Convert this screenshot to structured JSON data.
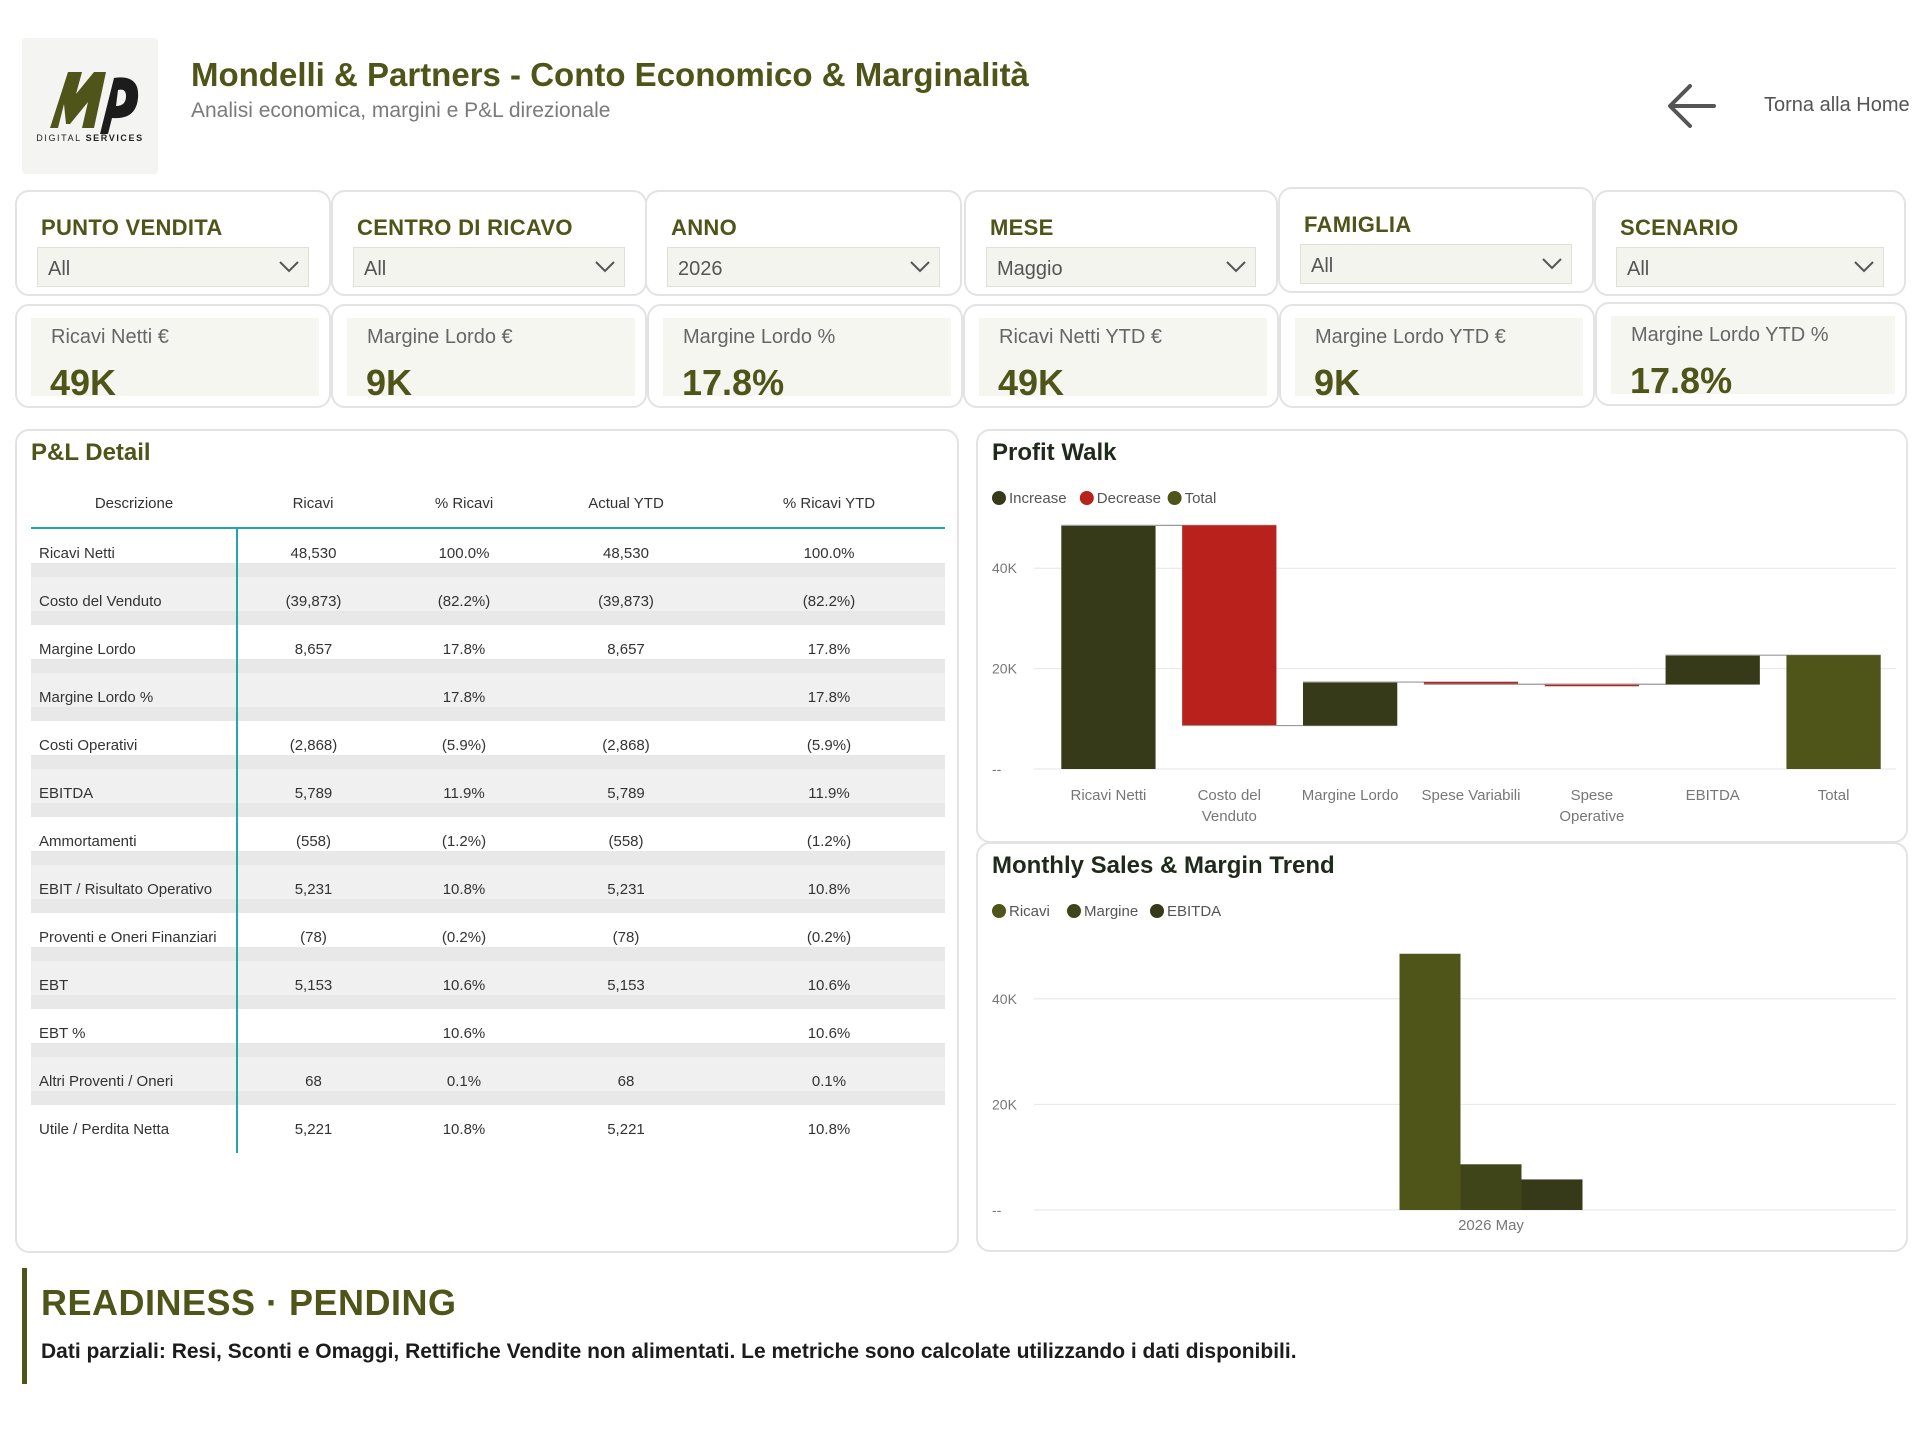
{
  "header": {
    "logo_caption_a": "DIGITAL",
    "logo_caption_b": "SERVICES",
    "title": "Mondelli & Partners - Conto Economico & Marginalità",
    "subtitle": "Analisi economica, margini e P&L direzionale",
    "back_label": "Torna alla Home",
    "back_icon": "arrow-left-icon"
  },
  "slicers": [
    {
      "title": "PUNTO VENDITA",
      "value": "All"
    },
    {
      "title": "CENTRO DI RICAVO",
      "value": "All"
    },
    {
      "title": "ANNO",
      "value": "2026"
    },
    {
      "title": "MESE",
      "value": "Maggio"
    },
    {
      "title": "FAMIGLIA",
      "value": "All"
    },
    {
      "title": "SCENARIO",
      "value": "All"
    }
  ],
  "kpis": [
    {
      "label": "Ricavi Netti €",
      "value": "49K"
    },
    {
      "label": "Margine Lordo €",
      "value": "9K"
    },
    {
      "label": "Margine Lordo %",
      "value": "17.8%"
    },
    {
      "label": "Ricavi Netti YTD €",
      "value": "49K"
    },
    {
      "label": "Margine Lordo YTD €",
      "value": "9K"
    },
    {
      "label": "Margine Lordo YTD %",
      "value": "17.8%"
    }
  ],
  "pl": {
    "title": "P&L Detail",
    "columns": [
      "Descrizione",
      "Ricavi",
      "% Ricavi",
      "Actual YTD",
      "% Ricavi YTD"
    ],
    "rows": [
      [
        "Ricavi Netti",
        "48,530",
        "100.0%",
        "48,530",
        "100.0%"
      ],
      [
        "Costo del Venduto",
        "(39,873)",
        "(82.2%)",
        "(39,873)",
        "(82.2%)"
      ],
      [
        "Margine Lordo",
        "8,657",
        "17.8%",
        "8,657",
        "17.8%"
      ],
      [
        "Margine Lordo %",
        "",
        "17.8%",
        "",
        "17.8%"
      ],
      [
        "Costi Operativi",
        "(2,868)",
        "(5.9%)",
        "(2,868)",
        "(5.9%)"
      ],
      [
        "EBITDA",
        "5,789",
        "11.9%",
        "5,789",
        "11.9%"
      ],
      [
        "Ammortamenti",
        "(558)",
        "(1.2%)",
        "(558)",
        "(1.2%)"
      ],
      [
        "EBIT / Risultato Operativo",
        "5,231",
        "10.8%",
        "5,231",
        "10.8%"
      ],
      [
        "Proventi e Oneri Finanziari",
        "(78)",
        "(0.2%)",
        "(78)",
        "(0.2%)"
      ],
      [
        "EBT",
        "5,153",
        "10.6%",
        "5,153",
        "10.6%"
      ],
      [
        "EBT %",
        "",
        "10.6%",
        "",
        "10.6%"
      ],
      [
        "Altri Proventi / Oneri",
        "68",
        "0.1%",
        "68",
        "0.1%"
      ],
      [
        "Utile / Perdita Netta",
        "5,221",
        "10.8%",
        "5,221",
        "10.8%"
      ]
    ]
  },
  "chart_data": [
    {
      "type": "bar",
      "subtype": "waterfall",
      "title": "Profit Walk",
      "legend": [
        "Increase",
        "Decrease",
        "Total"
      ],
      "legend_position": "top-left",
      "colors": {
        "Increase": "#363a18",
        "Decrease": "#b8211c",
        "Total": "#4f5419"
      },
      "yticks": [
        "--",
        "20K",
        "40K"
      ],
      "ylim": [
        0,
        50000
      ],
      "grid": true,
      "categories": [
        "Ricavi Netti",
        "Costo del Venduto",
        "Margine Lordo",
        "Spese Variabili",
        "Spese Operative",
        "EBITDA",
        "Total"
      ],
      "bars": [
        {
          "category": "Ricavi Netti",
          "kind": "Increase",
          "start": 0,
          "end": 48530
        },
        {
          "category": "Costo del Venduto",
          "kind": "Decrease",
          "start": 48530,
          "end": 8657
        },
        {
          "category": "Margine Lordo",
          "kind": "Increase",
          "start": 8657,
          "end": 17314
        },
        {
          "category": "Spese Variabili",
          "kind": "Decrease",
          "start": 17314,
          "end": 16880
        },
        {
          "category": "Spese Operative",
          "kind": "Decrease",
          "start": 16880,
          "end": 16880
        },
        {
          "category": "EBITDA",
          "kind": "Increase",
          "start": 16880,
          "end": 22669
        },
        {
          "category": "Total",
          "kind": "Total",
          "start": 0,
          "end": 22669
        }
      ]
    },
    {
      "type": "bar",
      "title": "Monthly Sales & Margin Trend",
      "legend_position": "top-left",
      "yticks": [
        "--",
        "20K",
        "40K"
      ],
      "ylim": [
        0,
        50000
      ],
      "grid": true,
      "categories": [
        "2026 May"
      ],
      "series": [
        {
          "name": "Ricavi",
          "color": "#4f5419",
          "values": [
            48530
          ]
        },
        {
          "name": "Margine",
          "color": "#3f4518",
          "values": [
            8657
          ]
        },
        {
          "name": "EBITDA",
          "color": "#363a18",
          "values": [
            5789
          ]
        }
      ]
    }
  ],
  "readiness": {
    "title": "READINESS · PENDING",
    "text": "Dati parziali: Resi, Sconti e Omaggi, Rettifiche Vendite non alimentati. Le metriche sono calcolate utilizzando i dati disponibili."
  }
}
